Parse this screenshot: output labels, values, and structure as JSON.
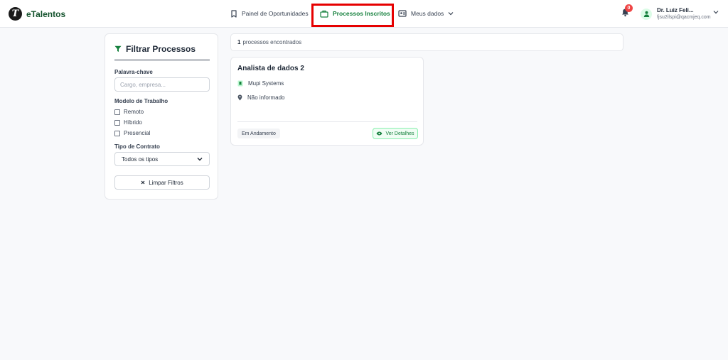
{
  "brand": {
    "name": "eTalentos",
    "logo_letter": "T"
  },
  "nav": {
    "items": [
      {
        "label": "Painel de Oportunidades",
        "icon": "bookmark-icon"
      },
      {
        "label": "Processos Inscritos",
        "icon": "briefcase-icon",
        "active": true
      },
      {
        "label": "Meus dados",
        "icon": "id-card-icon"
      }
    ]
  },
  "notifications": {
    "count": "0"
  },
  "user": {
    "name": "Dr. Luiz Feli...",
    "email": "fjsu2ilspi@qacmjeq.com"
  },
  "filters": {
    "title": "Filtrar Processos",
    "keyword_label": "Palavra-chave",
    "keyword_placeholder": "Cargo, empresa...",
    "model_label": "Modelo de Trabalho",
    "model_options": [
      "Remoto",
      "Híbrido",
      "Presencial"
    ],
    "contract_label": "Tipo de Contrato",
    "contract_selected": "Todos os tipos",
    "clear_label": "Limpar Filtros"
  },
  "results": {
    "count": "1",
    "suffix": "processos encontrados"
  },
  "card": {
    "title": "Analista de dados 2",
    "company": "Mupi Systems",
    "location": "Não informado",
    "status": "Em Andamento",
    "details_label": "Ver Detalhes"
  },
  "colors": {
    "accent": "#15803d",
    "highlight": "#e60000",
    "badge": "#ef4444"
  }
}
